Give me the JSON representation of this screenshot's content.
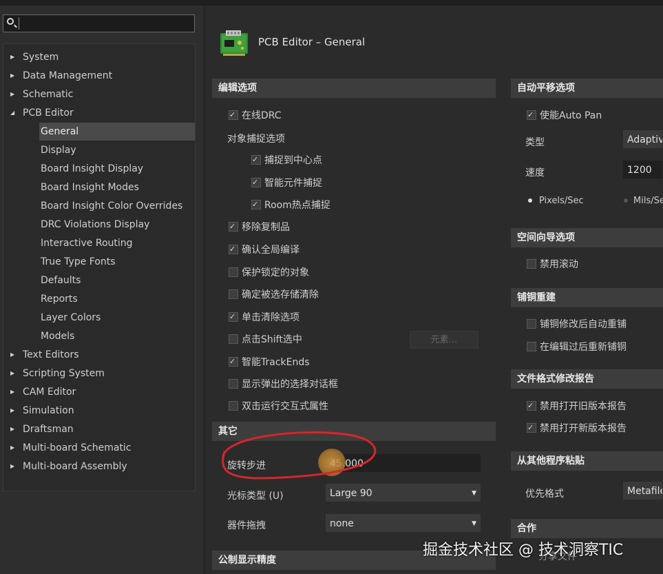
{
  "search": {
    "placeholder": "",
    "value": ""
  },
  "tree": [
    {
      "label": "System",
      "level": 0,
      "expanded": false
    },
    {
      "label": "Data Management",
      "level": 0,
      "expanded": false
    },
    {
      "label": "Schematic",
      "level": 0,
      "expanded": false
    },
    {
      "label": "PCB Editor",
      "level": 0,
      "expanded": true
    },
    {
      "label": "General",
      "level": 1,
      "selected": true
    },
    {
      "label": "Display",
      "level": 1
    },
    {
      "label": "Board Insight Display",
      "level": 1
    },
    {
      "label": "Board Insight Modes",
      "level": 1
    },
    {
      "label": "Board Insight Color Overrides",
      "level": 1
    },
    {
      "label": "DRC Violations Display",
      "level": 1
    },
    {
      "label": "Interactive Routing",
      "level": 1
    },
    {
      "label": "True Type Fonts",
      "level": 1
    },
    {
      "label": "Defaults",
      "level": 1
    },
    {
      "label": "Reports",
      "level": 1
    },
    {
      "label": "Layer Colors",
      "level": 1
    },
    {
      "label": "Models",
      "level": 1
    },
    {
      "label": "Text Editors",
      "level": 0,
      "expanded": false
    },
    {
      "label": "Scripting System",
      "level": 0,
      "expanded": false
    },
    {
      "label": "CAM Editor",
      "level": 0,
      "expanded": false
    },
    {
      "label": "Simulation",
      "level": 0,
      "expanded": false
    },
    {
      "label": "Draftsman",
      "level": 0,
      "expanded": false
    },
    {
      "label": "Multi-board Schematic",
      "level": 0,
      "expanded": false
    },
    {
      "label": "Multi-board Assembly",
      "level": 0,
      "expanded": false
    }
  ],
  "header": {
    "title": "PCB Editor – General",
    "icon": "pcb-board-icon"
  },
  "edit_options": {
    "title": "编辑选项",
    "online_drc": {
      "label": "在线DRC",
      "checked": true
    },
    "snap_group_label": "对象捕捉选项",
    "snap_center": {
      "label": "捕捉到中心点",
      "checked": true
    },
    "smart_component_snap": {
      "label": "智能元件捕捉",
      "checked": true
    },
    "room_hotspot_snap": {
      "label": "Room热点捕捉",
      "checked": true
    },
    "remove_duplicates": {
      "label": "移除复制品",
      "checked": true
    },
    "confirm_global_edit": {
      "label": "确认全局编译",
      "checked": true
    },
    "protect_locked": {
      "label": "保护锁定的对象",
      "checked": false
    },
    "confirm_clear_selection": {
      "label": "确定被选存储清除",
      "checked": false
    },
    "click_clear_selection": {
      "label": "单击清除选项",
      "checked": true
    },
    "shift_click_select": {
      "label": "点击Shift选中",
      "checked": false
    },
    "primitives_button": "元素...",
    "smart_trackends": {
      "label": "智能TrackEnds",
      "checked": true
    },
    "show_popup_dialog": {
      "label": "显示弹出的选择对话框",
      "checked": false
    },
    "double_click_props": {
      "label": "双击运行交互式属性",
      "checked": false
    }
  },
  "other": {
    "title": "其它",
    "rotation_step": {
      "label": "旋转步进",
      "value": "45.000"
    },
    "cursor_type": {
      "label": "光标类型 (U)",
      "value": "Large 90"
    },
    "component_drag": {
      "label": "器件拖拽",
      "value": "none"
    }
  },
  "metric_precision": {
    "title": "公制显示精度"
  },
  "autopan": {
    "title": "自动平移选项",
    "enable": {
      "label": "使能Auto Pan",
      "checked": true
    },
    "type_label": "类型",
    "type_value": "Adaptive",
    "speed_label": "速度",
    "speed_value": "1200",
    "unit_pixels": "Pixels/Sec",
    "unit_mils": "Mils/Sec",
    "selected_unit": "pixels"
  },
  "space_nav": {
    "title": "空间向导选项",
    "disable_roll": {
      "label": "禁用滚动",
      "checked": false
    }
  },
  "polygon_rebuild": {
    "title": "铺铜重建",
    "repour_after_modify": {
      "label": "铺铜修改后自动重铺",
      "checked": false
    },
    "repour_after_edit": {
      "label": "在编辑过后重新铺铜",
      "checked": false
    }
  },
  "file_format_report": {
    "title": "文件格式修改报告",
    "disable_open_old": {
      "label": "禁用打开旧版本报告",
      "checked": true
    },
    "disable_open_new": {
      "label": "禁用打开新版本报告",
      "checked": true
    }
  },
  "paste_from_other": {
    "title": "从其他程序粘贴",
    "preferred_format_label": "优先格式",
    "preferred_format_value": "Metafile"
  },
  "collab": {
    "title": "合作",
    "share_files_partial": "分享文件"
  },
  "watermark": "掘金技术社区 @ 技术洞察TIC",
  "colors": {
    "annotation_red": "#d8262a",
    "panel_bg": "#2b2b2b",
    "section_bg": "#3d3d3d"
  }
}
